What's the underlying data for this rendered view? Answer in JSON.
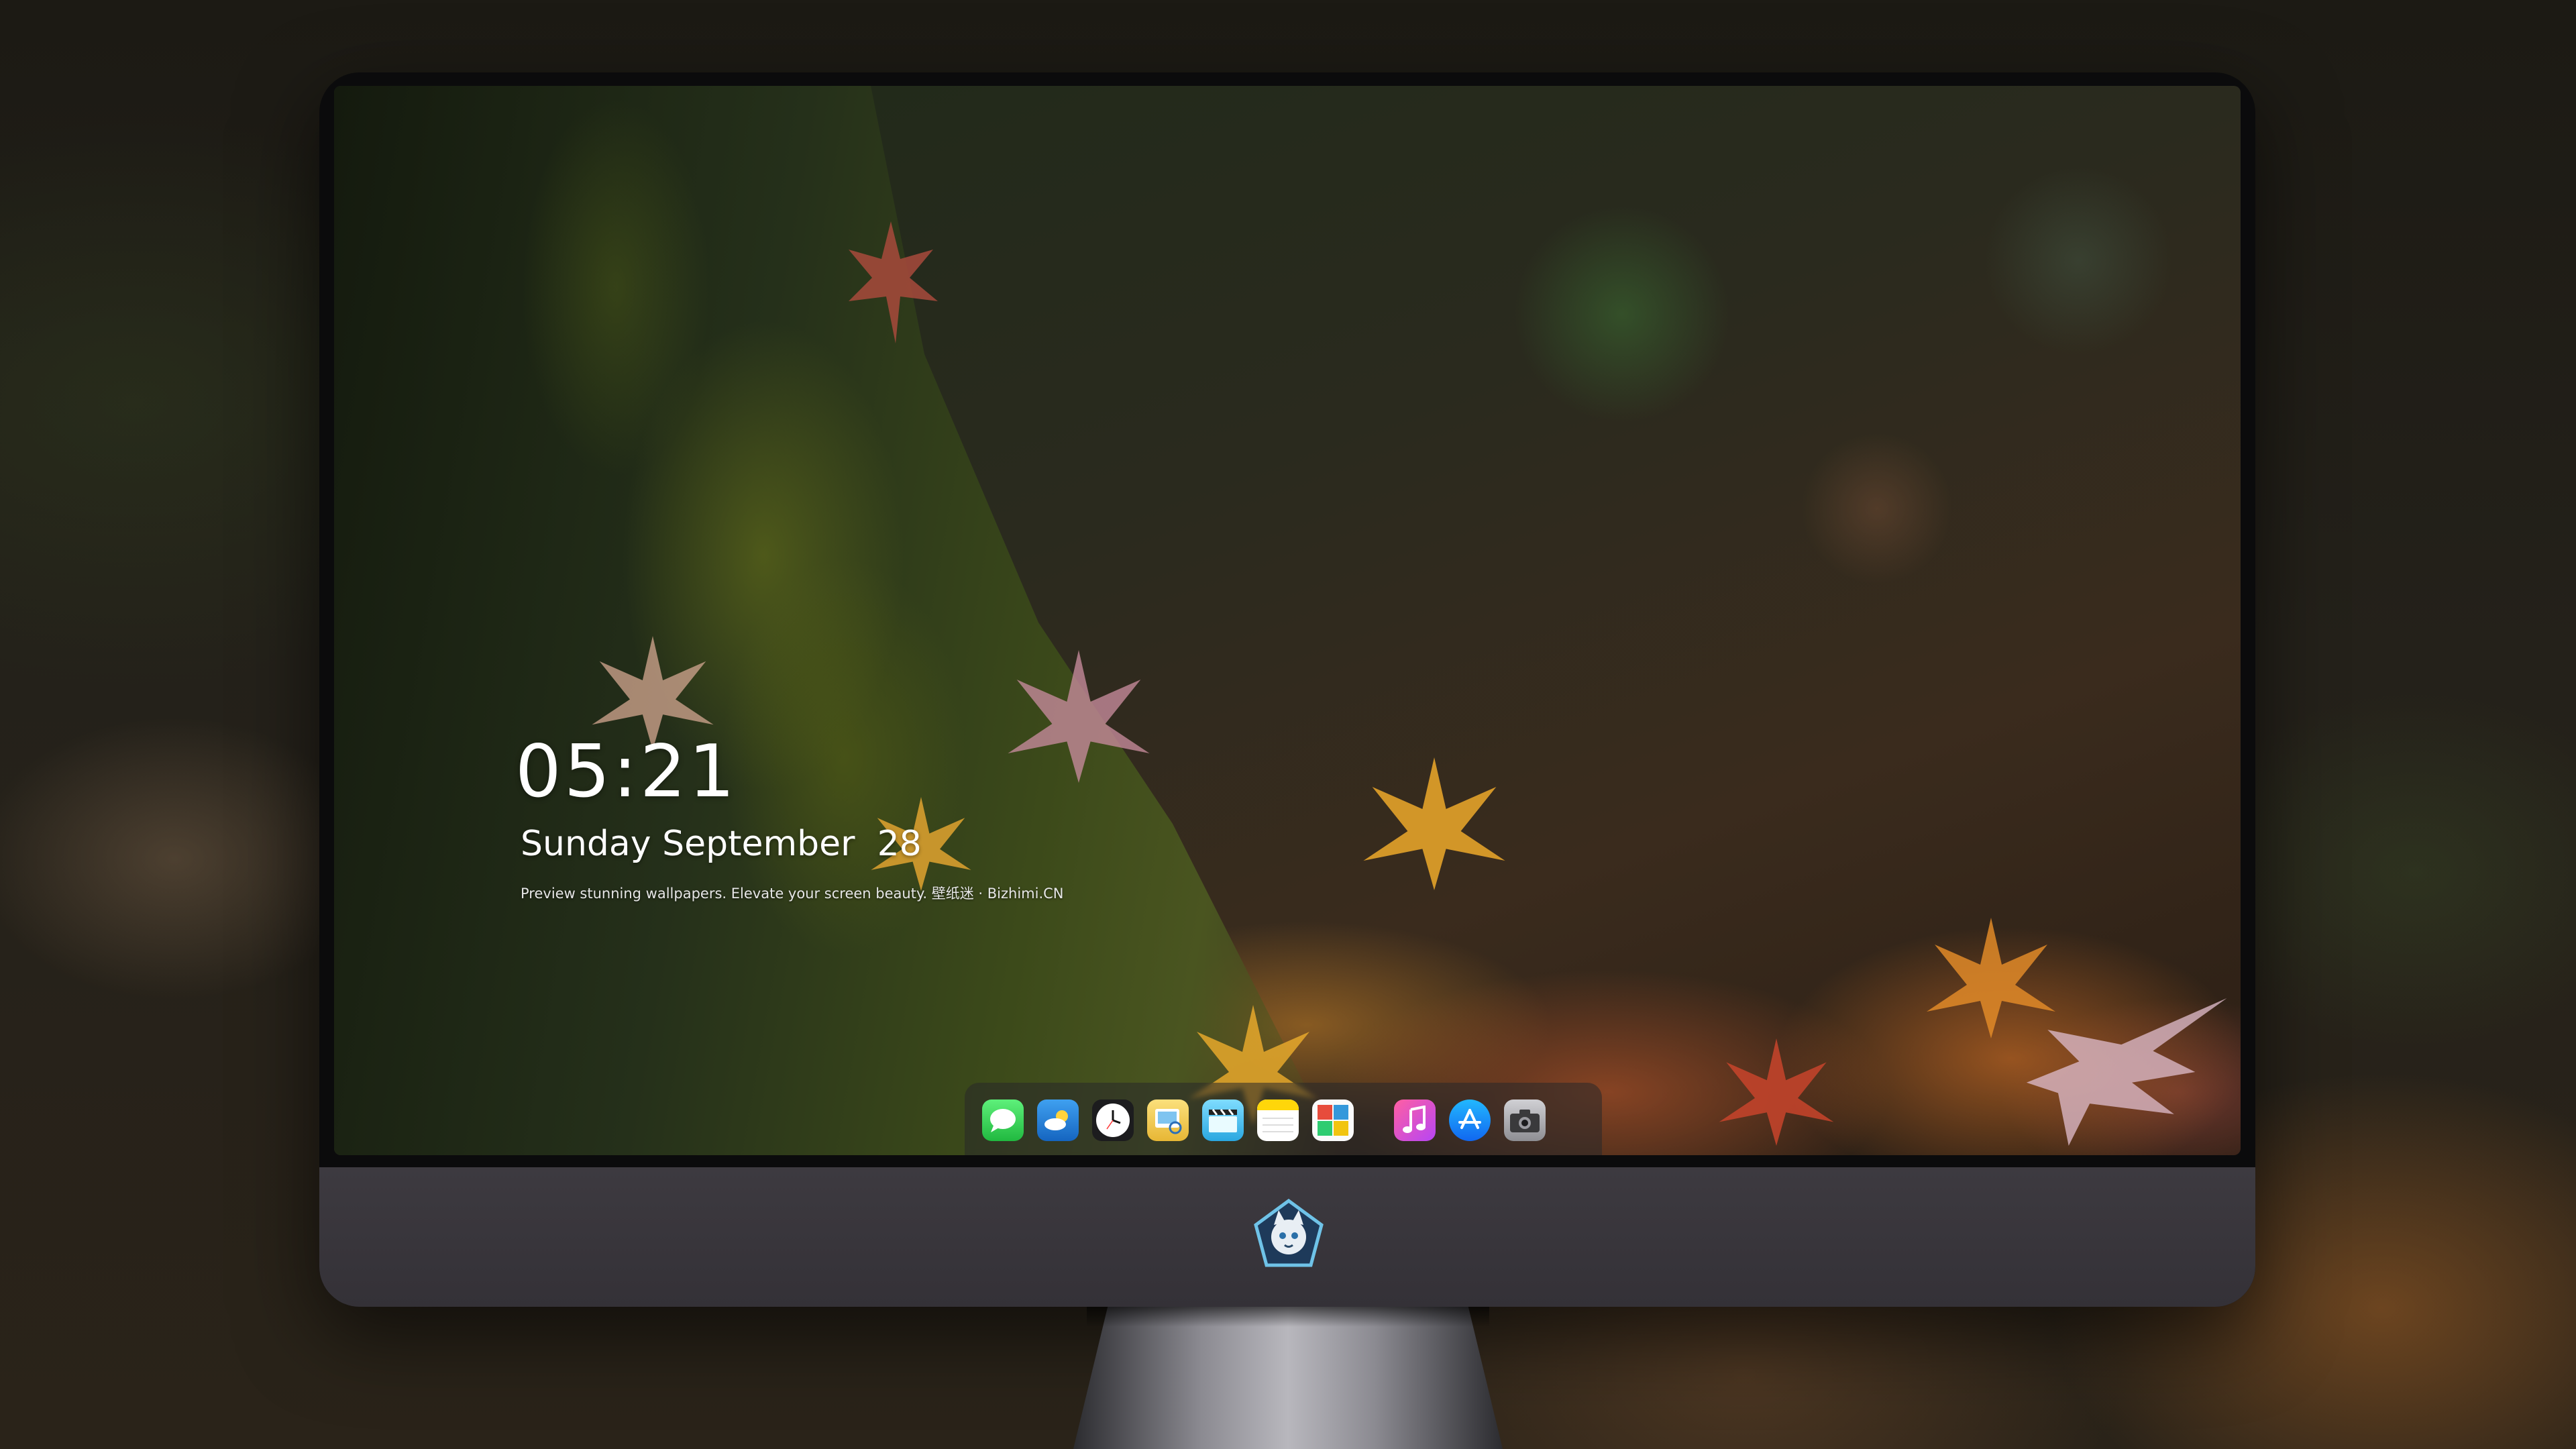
{
  "lockscreen": {
    "time": "05:21",
    "date": "Sunday September  28",
    "caption": "Preview stunning wallpapers. Elevate your screen beauty. 壁纸迷 · Bizhimi.CN"
  },
  "dock": {
    "apps": [
      {
        "name": "messages-icon",
        "color": "#34c759"
      },
      {
        "name": "weather-icon",
        "color": "#1e88e5"
      },
      {
        "name": "clock-icon",
        "color": "#ffffff"
      },
      {
        "name": "preview-icon",
        "color": "#f5c542"
      },
      {
        "name": "imovie-icon",
        "color": "#5ac8fa"
      },
      {
        "name": "notes-icon",
        "color": "#ffd60a"
      },
      {
        "name": "photo-booth-icon",
        "color": "#e74c3c"
      },
      {
        "name": "music-icon",
        "color": "#fc3c8d"
      },
      {
        "name": "app-store-icon",
        "color": "#1c8cf5"
      },
      {
        "name": "camera-icon",
        "color": "#8e8e93"
      }
    ]
  }
}
